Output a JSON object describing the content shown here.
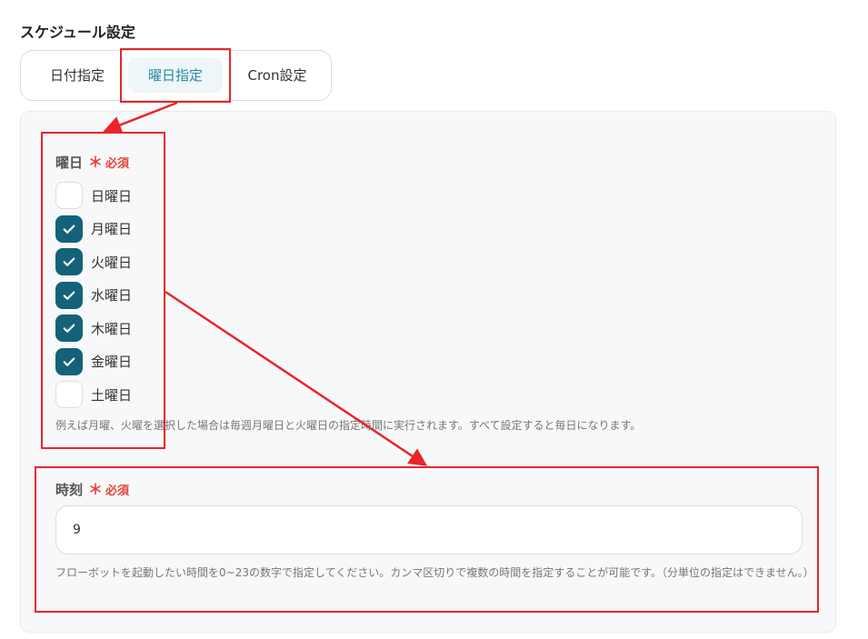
{
  "section": {
    "title": "スケジュール設定"
  },
  "tabs": [
    {
      "label": "日付指定",
      "active": false
    },
    {
      "label": "曜日指定",
      "active": true
    },
    {
      "label": "Cron設定",
      "active": false
    }
  ],
  "weekday_field": {
    "label": "曜日",
    "required_mark": "＊",
    "required_text": "必須",
    "days": [
      {
        "label": "日曜日",
        "checked": false
      },
      {
        "label": "月曜日",
        "checked": true
      },
      {
        "label": "火曜日",
        "checked": true
      },
      {
        "label": "水曜日",
        "checked": true
      },
      {
        "label": "木曜日",
        "checked": true
      },
      {
        "label": "金曜日",
        "checked": true
      },
      {
        "label": "土曜日",
        "checked": false
      }
    ],
    "help": "例えば月曜、火曜を選択した場合は毎週月曜日と火曜日の指定時間に実行されます。すべて設定すると毎日になります。"
  },
  "time_field": {
    "label": "時刻",
    "required_mark": "＊",
    "required_text": "必須",
    "value": "9",
    "help": "フローボットを起動したい時間を0~23の数字で指定してください。カンマ区切りで複数の時間を指定することが可能です。（分単位の指定はできません。）"
  },
  "colors": {
    "accent": "#13627a",
    "active_tab_text": "#2a8aa0",
    "required": "#e8443a",
    "annotation": "#e8262a"
  }
}
